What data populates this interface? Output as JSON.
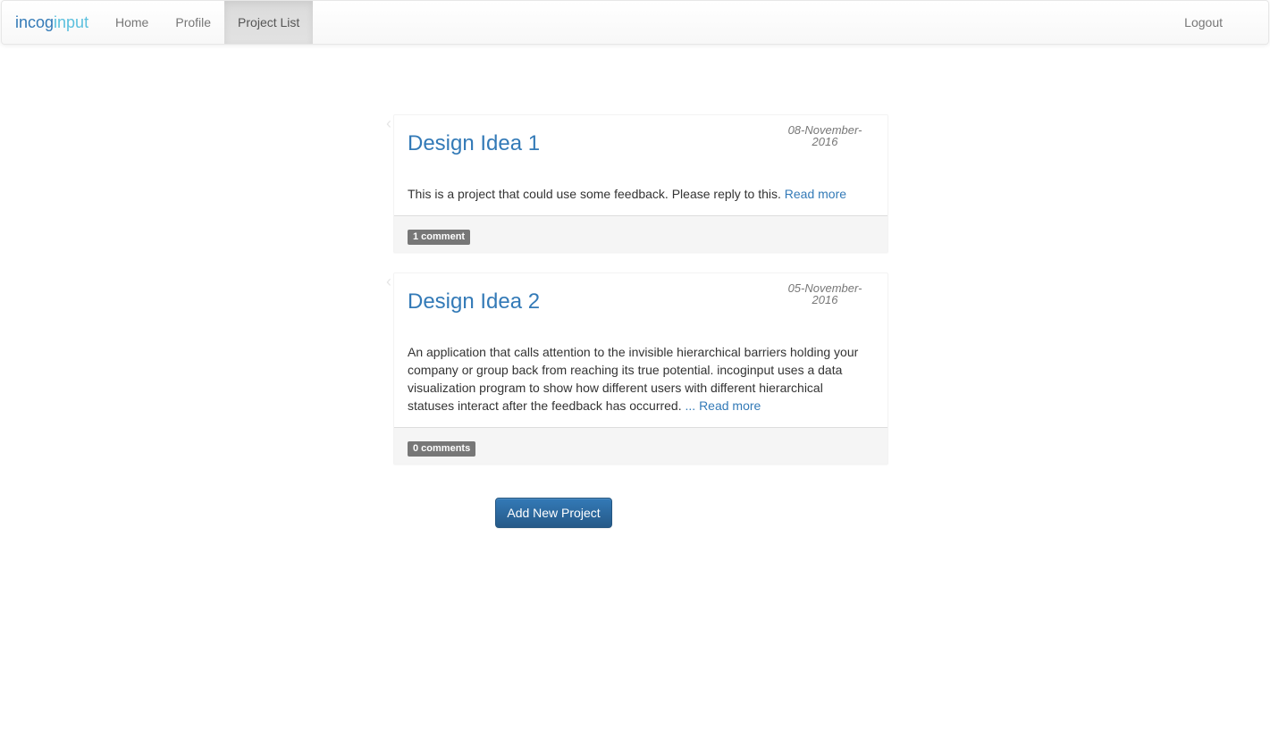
{
  "navbar": {
    "brand_part1": "incog",
    "brand_part2": "input",
    "links": [
      "Home",
      "Profile",
      "Project List"
    ],
    "active_link": "Project List",
    "logout_label": "Logout"
  },
  "projects": [
    {
      "title": "Design Idea 1",
      "date_line1": "08-November-",
      "date_line2": "2016",
      "description": "This is a project that could use some feedback. Please reply to this.",
      "read_more": "Read more",
      "comments_badge": "1 comment"
    },
    {
      "title": "Design Idea 2",
      "date_line1": "05-November-",
      "date_line2": "2016",
      "description": "An application that calls attention to the invisible hierarchical barriers holding your company or group back from reaching its true potential. incoginput uses a data visualization program to show how different users with different hierarchical statuses interact after the feedback has occurred.",
      "read_more": "... Read more",
      "comments_badge": "0 comments"
    }
  ],
  "add_project_label": "Add New Project",
  "colors": {
    "link": "#337ab7",
    "brand_accent": "#5bc0de",
    "badge": "#777777",
    "button": "#265a88"
  },
  "icons": {
    "panel_arrow": "chevron-left-icon"
  }
}
